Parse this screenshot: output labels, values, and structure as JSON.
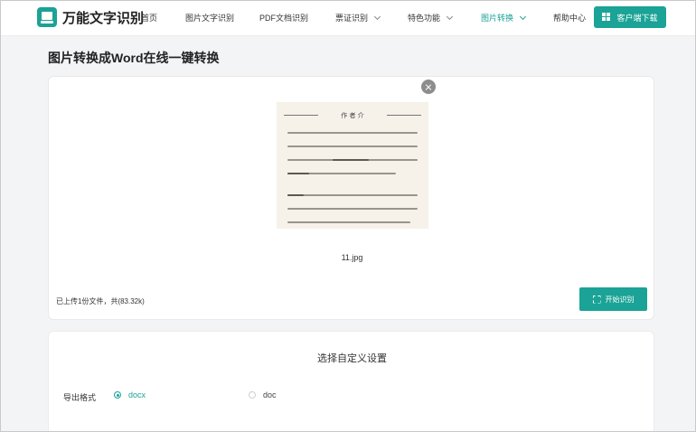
{
  "app": {
    "name": "万能文字识别"
  },
  "nav": {
    "items": [
      {
        "label": "首页",
        "has_dropdown": false,
        "active": false
      },
      {
        "label": "图片文字识别",
        "has_dropdown": false,
        "active": false
      },
      {
        "label": "PDF文档识别",
        "has_dropdown": false,
        "active": false
      },
      {
        "label": "票证识别",
        "has_dropdown": true,
        "active": false
      },
      {
        "label": "特色功能",
        "has_dropdown": true,
        "active": false
      },
      {
        "label": "图片转换",
        "has_dropdown": true,
        "active": true
      },
      {
        "label": "帮助中心",
        "has_dropdown": false,
        "active": false
      }
    ],
    "download_label": "客户端下载"
  },
  "page": {
    "title": "图片转换成Word在线一键转换"
  },
  "upload": {
    "thumbnail_heading": "作 者 介",
    "file_name": "11.jpg",
    "status": "已上传1份文件，共(83.32k)",
    "start_label": "开始识别"
  },
  "settings": {
    "title": "选择自定义设置",
    "format_label": "导出格式",
    "formats": [
      {
        "label": "docx",
        "selected": true
      },
      {
        "label": "doc",
        "selected": false
      }
    ]
  },
  "colors": {
    "accent": "#1aa396",
    "background": "#f3f4f6"
  }
}
